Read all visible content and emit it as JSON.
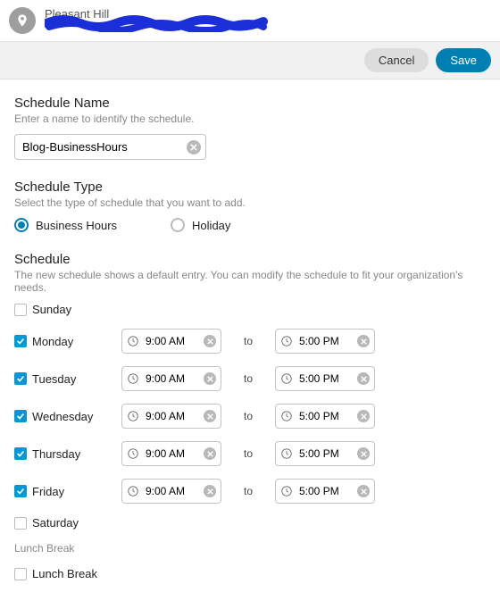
{
  "location": {
    "name": "Pleasant Hill"
  },
  "actions": {
    "cancel": "Cancel",
    "save": "Save"
  },
  "scheduleName": {
    "label": "Schedule Name",
    "help": "Enter a name to identify the schedule.",
    "value": "Blog-BusinessHours"
  },
  "scheduleType": {
    "label": "Schedule Type",
    "help": "Select the type of schedule that you want to add.",
    "options": {
      "business": "Business Hours",
      "holiday": "Holiday"
    },
    "selected": "business"
  },
  "schedule": {
    "label": "Schedule",
    "help": "The new schedule shows a default entry. You can modify the schedule to fit your organization's needs.",
    "toLabel": "to",
    "days": [
      {
        "name": "Sunday",
        "checked": false,
        "start": "",
        "end": ""
      },
      {
        "name": "Monday",
        "checked": true,
        "start": "9:00 AM",
        "end": "5:00 PM"
      },
      {
        "name": "Tuesday",
        "checked": true,
        "start": "9:00 AM",
        "end": "5:00 PM"
      },
      {
        "name": "Wednesday",
        "checked": true,
        "start": "9:00 AM",
        "end": "5:00 PM"
      },
      {
        "name": "Thursday",
        "checked": true,
        "start": "9:00 AM",
        "end": "5:00 PM"
      },
      {
        "name": "Friday",
        "checked": true,
        "start": "9:00 AM",
        "end": "5:00 PM"
      },
      {
        "name": "Saturday",
        "checked": false,
        "start": "",
        "end": ""
      }
    ]
  },
  "lunchBreak": {
    "sectionLabel": "Lunch Break",
    "checkboxLabel": "Lunch Break",
    "checked": false
  }
}
